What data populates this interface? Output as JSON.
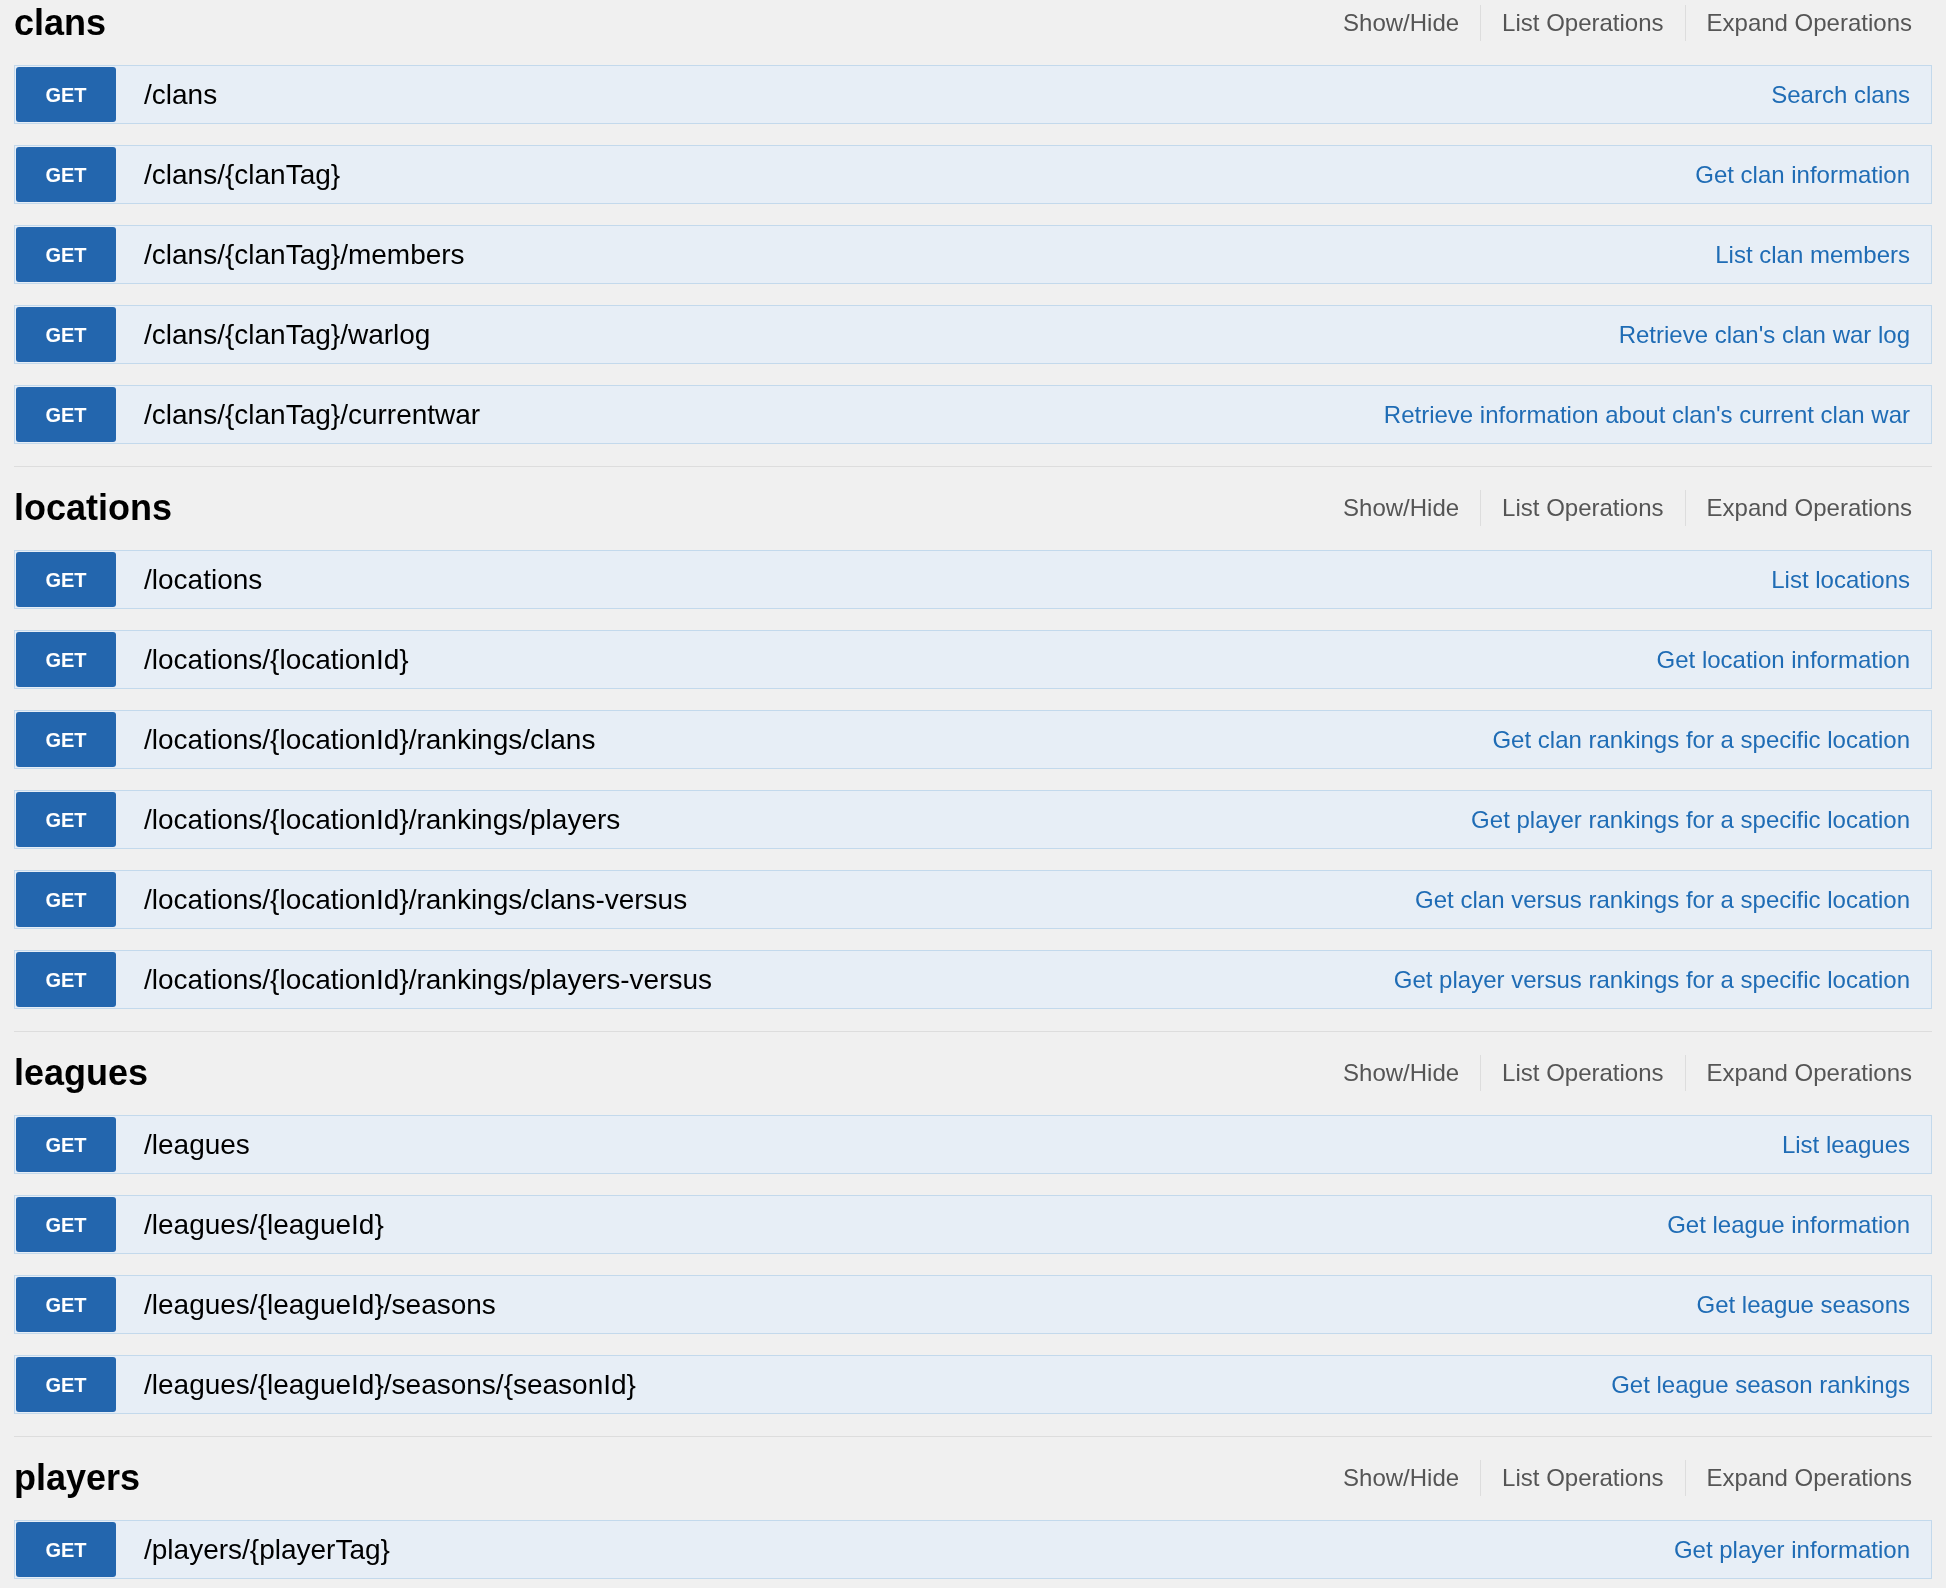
{
  "sections": [
    {
      "name": "clans",
      "links": [
        "Show/Hide",
        "List Operations",
        "Expand Operations"
      ],
      "operations": [
        {
          "method": "GET",
          "path": "/clans",
          "summary": "Search clans"
        },
        {
          "method": "GET",
          "path": "/clans/{clanTag}",
          "summary": "Get clan information"
        },
        {
          "method": "GET",
          "path": "/clans/{clanTag}/members",
          "summary": "List clan members"
        },
        {
          "method": "GET",
          "path": "/clans/{clanTag}/warlog",
          "summary": "Retrieve clan's clan war log"
        },
        {
          "method": "GET",
          "path": "/clans/{clanTag}/currentwar",
          "summary": "Retrieve information about clan's current clan war"
        }
      ]
    },
    {
      "name": "locations",
      "links": [
        "Show/Hide",
        "List Operations",
        "Expand Operations"
      ],
      "operations": [
        {
          "method": "GET",
          "path": "/locations",
          "summary": "List locations"
        },
        {
          "method": "GET",
          "path": "/locations/{locationId}",
          "summary": "Get location information"
        },
        {
          "method": "GET",
          "path": "/locations/{locationId}/rankings/clans",
          "summary": "Get clan rankings for a specific location"
        },
        {
          "method": "GET",
          "path": "/locations/{locationId}/rankings/players",
          "summary": "Get player rankings for a specific location"
        },
        {
          "method": "GET",
          "path": "/locations/{locationId}/rankings/clans-versus",
          "summary": "Get clan versus rankings for a specific location"
        },
        {
          "method": "GET",
          "path": "/locations/{locationId}/rankings/players-versus",
          "summary": "Get player versus rankings for a specific location"
        }
      ]
    },
    {
      "name": "leagues",
      "links": [
        "Show/Hide",
        "List Operations",
        "Expand Operations"
      ],
      "operations": [
        {
          "method": "GET",
          "path": "/leagues",
          "summary": "List leagues"
        },
        {
          "method": "GET",
          "path": "/leagues/{leagueId}",
          "summary": "Get league information"
        },
        {
          "method": "GET",
          "path": "/leagues/{leagueId}/seasons",
          "summary": "Get league seasons"
        },
        {
          "method": "GET",
          "path": "/leagues/{leagueId}/seasons/{seasonId}",
          "summary": "Get league season rankings"
        }
      ]
    },
    {
      "name": "players",
      "links": [
        "Show/Hide",
        "List Operations",
        "Expand Operations"
      ],
      "operations": [
        {
          "method": "GET",
          "path": "/players/{playerTag}",
          "summary": "Get player information"
        }
      ]
    }
  ]
}
